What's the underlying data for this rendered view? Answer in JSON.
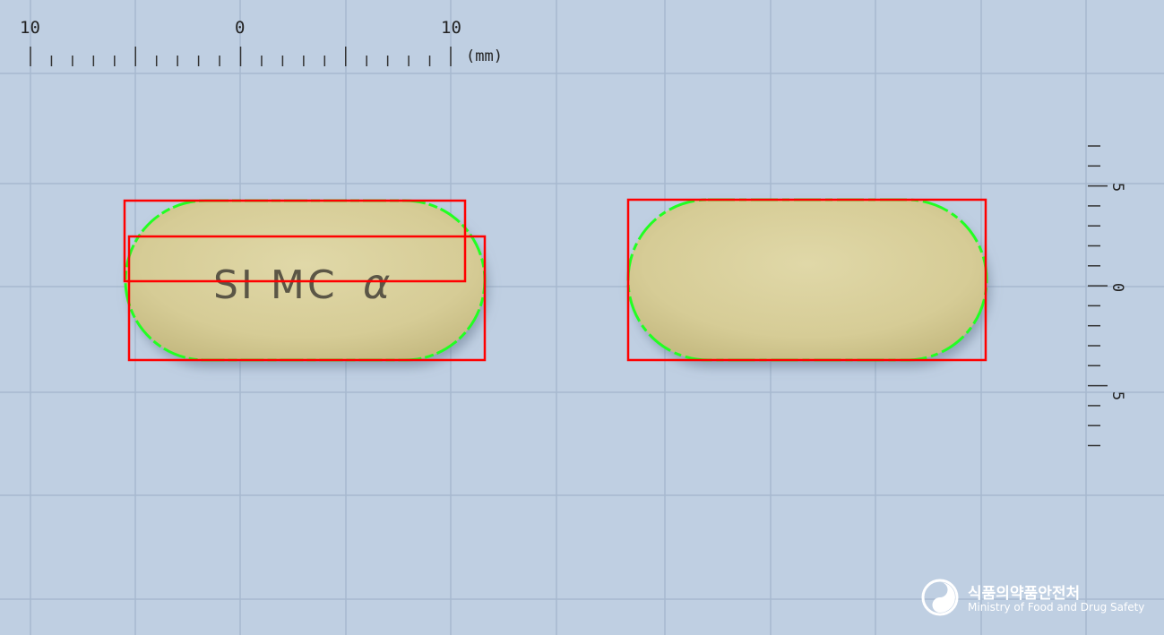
{
  "scale": {
    "horizontal_labels": [
      "10",
      "0",
      "10"
    ],
    "unit": "(mm)",
    "vertical_labels": [
      "5",
      "0",
      "5"
    ]
  },
  "pill_front": {
    "imprint_main": "SI MC",
    "imprint_symbol": "α",
    "color": "#d8cf9c"
  },
  "pill_back": {
    "color": "#dcd3a2"
  },
  "logo": {
    "korean": "식품의약품안전처",
    "english": "Ministry of Food and Drug Safety"
  },
  "colors": {
    "background": "#bfcfe2",
    "grid": "#a7b9cf",
    "bbox": "#ff0000",
    "contour": "#22ff22"
  }
}
